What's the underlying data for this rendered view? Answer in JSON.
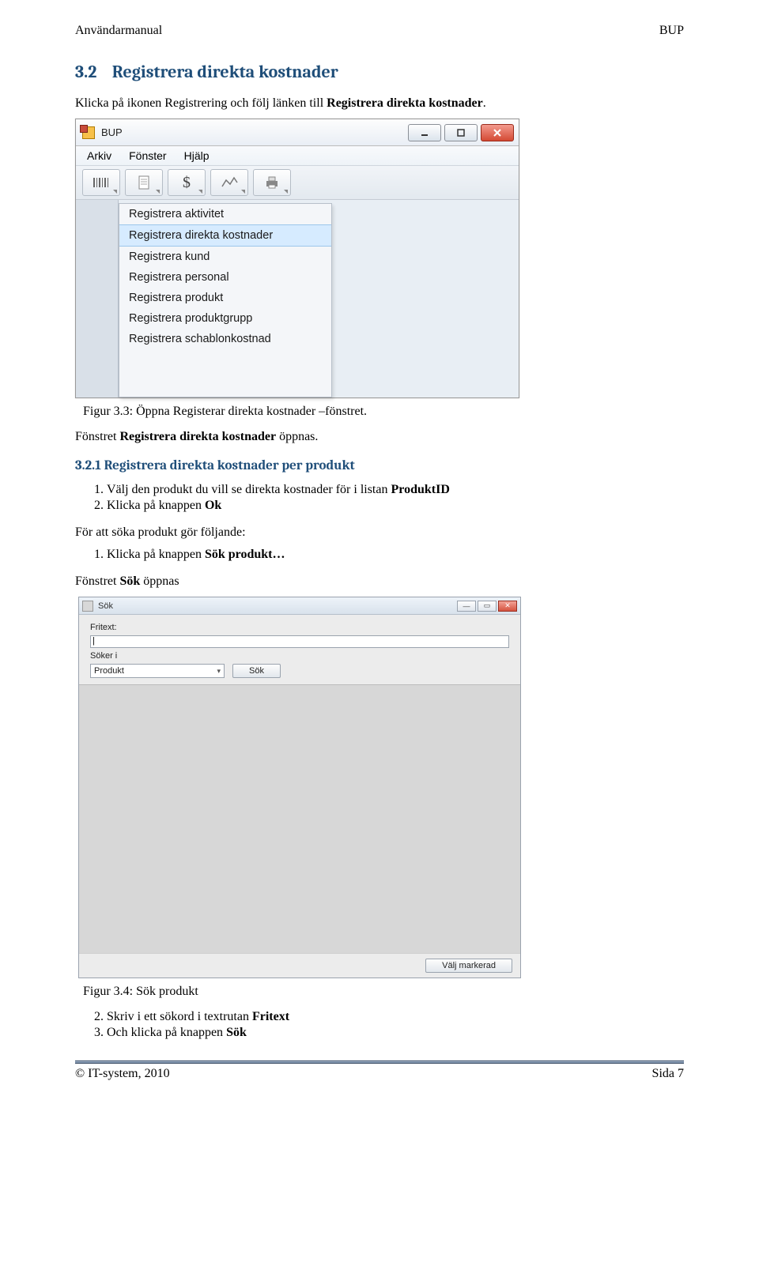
{
  "header": {
    "left": "Användarmanual",
    "right": "BUP"
  },
  "section": {
    "number": "3.2",
    "title": "Registrera direkta kostnader"
  },
  "intro_parts": {
    "a": "Klicka på ikonen Registrering och följ länken till ",
    "b": "Registrera direkta kostnader",
    "c": "."
  },
  "fig1": {
    "app_title": "BUP",
    "menus": [
      "Arkiv",
      "Fönster",
      "Hjälp"
    ],
    "toolbar_icons": [
      "barcode-icon",
      "doc-icon",
      "dollar-icon",
      "chart-icon",
      "printer-icon"
    ],
    "dollar_glyph": "$",
    "dropdown_items": [
      "Registrera aktivitet",
      "Registrera direkta kostnader",
      "Registrera kund",
      "Registrera personal",
      "Registrera produkt",
      "Registrera produktgrupp",
      "Registrera schablonkostnad"
    ],
    "dropdown_selected_index": 1
  },
  "caption1": "Figur 3.3: Öppna Registerar direkta kostnader –fönstret.",
  "para2_parts": {
    "a": "Fönstret ",
    "b": "Registrera direkta kostnader",
    "c": " öppnas."
  },
  "subsection": "3.2.1 Registrera direkta kostnader per produkt",
  "steps1": [
    {
      "pre": "Välj den produkt du vill se direkta kostnader för i listan ",
      "bold": "ProduktID"
    },
    {
      "pre": "Klicka på knappen ",
      "bold": "Ok"
    }
  ],
  "search_intro": "För att söka produkt gör följande:",
  "search_steps": [
    {
      "pre": "Klicka på knappen ",
      "bold": "Sök produkt…"
    }
  ],
  "para3_parts": {
    "a": "Fönstret ",
    "b": "Sök",
    "c": " öppnas"
  },
  "fig2": {
    "title": "Sök",
    "lbl_fritext": "Fritext:",
    "lbl_soker": "Söker i",
    "select_value": "Produkt",
    "btn_sok": "Sök",
    "btn_valj": "Välj markerad"
  },
  "caption2": "Figur 3.4: Sök produkt",
  "steps2": [
    {
      "num": "2.",
      "pre": "Skriv i ett sökord i textrutan ",
      "bold": "Fritext"
    },
    {
      "num": "3.",
      "pre": "Och klicka på knappen ",
      "bold": "Sök"
    }
  ],
  "footer": {
    "left": "© IT-system, 2010",
    "right": "Sida 7"
  }
}
